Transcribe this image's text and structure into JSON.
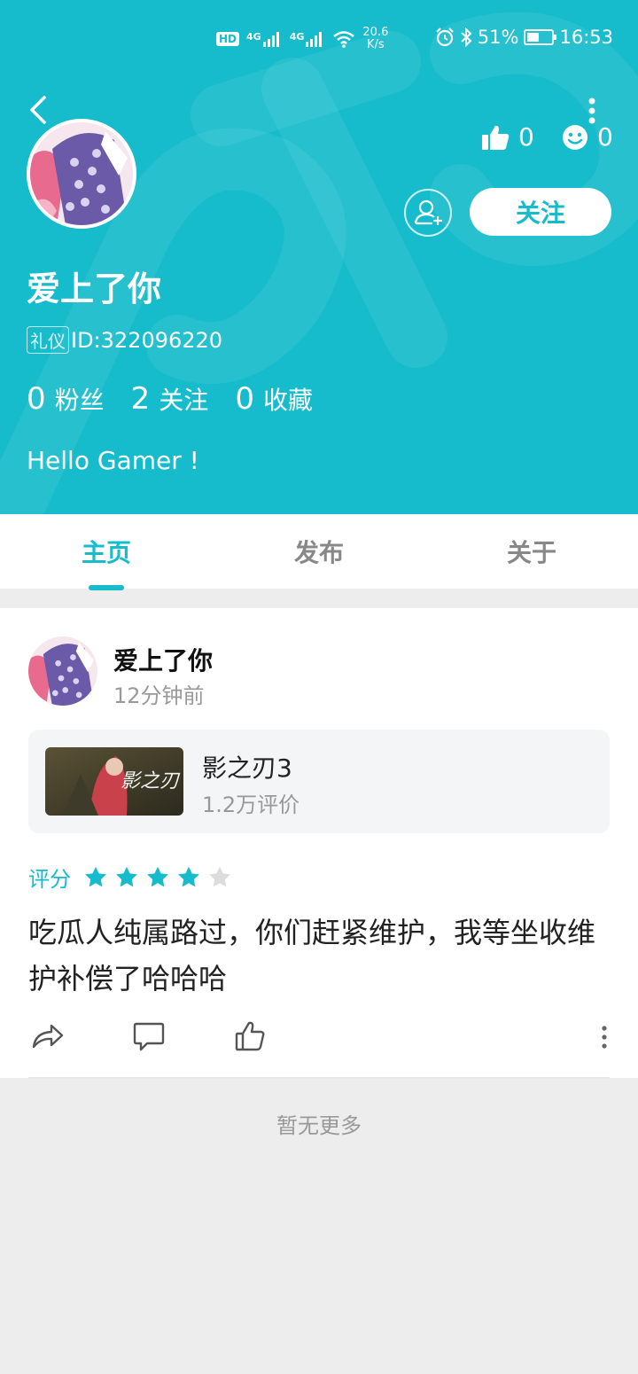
{
  "status_bar": {
    "hd": "HD",
    "net1": "4G",
    "net2": "4G",
    "speed_value": "20.6",
    "speed_unit": "K/s",
    "battery_percent": "51%",
    "battery_level": 0.51,
    "time": "16:53"
  },
  "profile": {
    "likes": "0",
    "reactions": "0",
    "follow_label": "关注",
    "name": "爱上了你",
    "id_tag": "礼仪",
    "id_text": "ID:322096220",
    "fans_count": "0",
    "fans_label": "粉丝",
    "following_count": "2",
    "following_label": "关注",
    "favorites_count": "0",
    "favorites_label": "收藏",
    "bio": "Hello Gamer !"
  },
  "tabs": [
    {
      "label": "主页",
      "active": true
    },
    {
      "label": "发布",
      "active": false
    },
    {
      "label": "关于",
      "active": false
    }
  ],
  "post": {
    "author": "爱上了你",
    "time": "12分钟前",
    "game": {
      "title": "影之刃3",
      "reviews": "1.2万评价",
      "thumb_text": "影之刃"
    },
    "rating_label": "评分",
    "rating": 4,
    "rating_max": 5,
    "text": "吃瓜人纯属路过，你们赶紧维护，我等坐收维护补偿了哈哈哈"
  },
  "footer": {
    "no_more": "暂无更多"
  },
  "colors": {
    "accent": "#16bccb",
    "star_empty": "#dcdcdc"
  },
  "icons": [
    "back-icon",
    "more-icon",
    "thumbs-up-icon",
    "smiley-icon",
    "add-friend-icon",
    "star-icon",
    "share-icon",
    "comment-icon",
    "like-icon",
    "alarm-icon",
    "bluetooth-icon",
    "wifi-icon",
    "signal-icon",
    "battery-icon"
  ]
}
